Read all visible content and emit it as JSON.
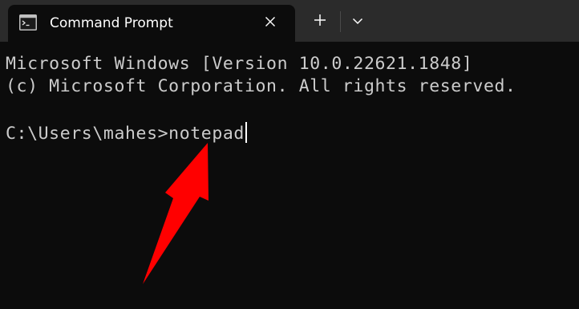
{
  "window": {
    "tab_title": "Command Prompt",
    "icons": {
      "tab": "cmd-terminal-icon",
      "close": "close-icon",
      "new_tab": "plus-icon",
      "dropdown": "chevron-down-icon"
    }
  },
  "terminal": {
    "banner_line1": "Microsoft Windows [Version 10.0.22621.1848]",
    "banner_line2": "(c) Microsoft Corporation. All rights reserved.",
    "prompt": "C:\\Users\\mahes>",
    "typed_command": "notepad"
  },
  "annotation": {
    "arrow_color": "#ff0000"
  },
  "colors": {
    "tabstrip_bg": "#2b2b2b",
    "terminal_bg": "#0c0c0c",
    "terminal_text": "#cccccc"
  }
}
